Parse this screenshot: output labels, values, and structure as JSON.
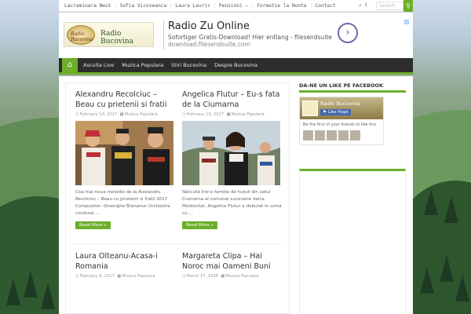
{
  "topbar": {
    "nav": [
      "Lacramioara Neut",
      "Sofia Vicoveanca",
      "Laura Lavric",
      "Pensioni –",
      "Formatie la Nunta",
      "Contact"
    ],
    "search_placeholder": "Search",
    "search_icon": "search-icon",
    "social_icons": [
      "rss-icon",
      "facebook-icon"
    ]
  },
  "header": {
    "logo_script": "Radio Bucovina",
    "logo_name": "Radio Bucovina"
  },
  "ad": {
    "title": "Radio Zu Online",
    "description": "Sofortiger Gratis-Download! Hier entlang - filesendsuite",
    "url": "download.filesendsuite.com",
    "button_icon": "chevron-right-icon"
  },
  "mainnav": {
    "home_icon": "home-icon",
    "items": [
      "Asculta Live",
      "Muzica Populara",
      "Stiri Bucovina",
      "Despre Bucovina"
    ]
  },
  "posts": [
    {
      "title": "Alexandru Recolciuc – Beau cu prietenii si fratii",
      "date": "February 10, 2017",
      "category": "Muzica Populara",
      "excerpt": "Cea mai noua melodie de la Alexandru Recolciuc – Beau cu prietenii si fratii 2017 Compozitor: Gheorghe Bianariuc Orchestra condusă …",
      "read_more": "Read More »"
    },
    {
      "title": "Angelica Flutur – Eu-s fata de la Ciumarna",
      "date": "February 10, 2017",
      "category": "Muzica Populara",
      "excerpt": "Născută într-o familie de huțuli din satul Ciumarna al comunei sucevene Vatra Moldoviței, Angelica Flutur a debutat în urmă cu …",
      "read_more": "Read More »"
    },
    {
      "title": "Laura Olteanu-Acasa-i Romania",
      "date": "February 6, 2017",
      "category": "Muzica Populara"
    },
    {
      "title": "Margareta Clipa – Hai Noroc mai Oameni Buni",
      "date": "March 17, 2016",
      "category": "Muzica Populara"
    }
  ],
  "sidebar": {
    "facebook_title": "Da-ne un like pe Facebook",
    "fb_page_name": "Radio Bucovina",
    "fb_like": "Like Page",
    "fb_friends_text": "Be the first of your friends to like this"
  },
  "colors": {
    "accent": "#6dae29",
    "nav_bg": "#2d2d2d"
  }
}
